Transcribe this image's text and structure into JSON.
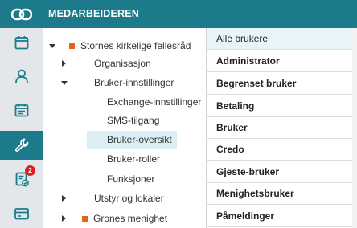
{
  "app": {
    "title": "MEDARBEIDEREN",
    "logo": "link-logo-icon"
  },
  "rail": {
    "items": [
      {
        "icon": "calendar-icon"
      },
      {
        "icon": "user-icon"
      },
      {
        "icon": "calendar-check-icon"
      },
      {
        "icon": "wrench-icon",
        "active": true
      },
      {
        "icon": "task-list-icon",
        "badge": "2"
      },
      {
        "icon": "card-icon"
      }
    ]
  },
  "tree": {
    "nodes": [
      {
        "label": "Stornes kirkelige fellesråd",
        "expanded": true
      },
      {
        "label": "Organisasjon",
        "expanded": false
      },
      {
        "label": "Bruker-innstillinger",
        "expanded": true
      },
      {
        "label": "Exchange-innstillinger"
      },
      {
        "label": "SMS-tilgang"
      },
      {
        "label": "Bruker-oversikt",
        "selected": true
      },
      {
        "label": "Bruker-roller"
      },
      {
        "label": "Funksjoner"
      },
      {
        "label": "Utstyr og lokaler",
        "expanded": false
      },
      {
        "label": "Grones menighet",
        "expanded": false
      }
    ]
  },
  "users_list": {
    "items": [
      "Alle brukere",
      "Administrator",
      "Begrenset bruker",
      "Betaling",
      "Bruker",
      "Credo",
      "Gjeste-bruker",
      "Menighetsbruker",
      "Påmeldinger"
    ]
  },
  "colors": {
    "accent": "#1c7a8a",
    "org_marker": "#e8621d",
    "badge": "#e02020",
    "selected": "#dcedf3"
  }
}
